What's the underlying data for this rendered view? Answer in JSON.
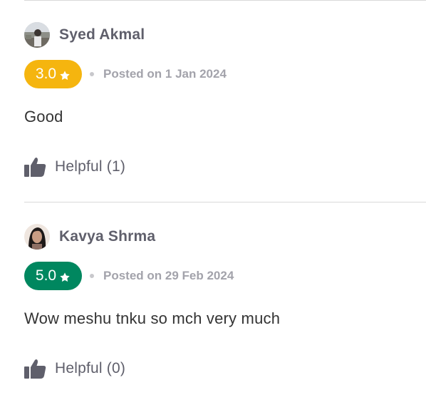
{
  "reviews": [
    {
      "reviewer_name": "Syed Akmal",
      "avatar": "photo-avatar-outdoor",
      "rating": "3.0",
      "rating_color": "#F5B50F",
      "star_icon": "star-icon",
      "posted_date": "Posted on 1 Jan 2024",
      "comment": "Good",
      "helpful_icon": "thumbs-up-icon",
      "helpful_label": "Helpful (1)"
    },
    {
      "reviewer_name": "Kavya Shrma",
      "avatar": "photo-avatar-portrait",
      "rating": "5.0",
      "rating_color": "#00875F",
      "star_icon": "star-icon",
      "posted_date": "Posted on 29 Feb 2024",
      "comment": "Wow meshu tnku so mch very much",
      "helpful_icon": "thumbs-up-icon",
      "helpful_label": "Helpful (0)"
    }
  ],
  "colors": {
    "name_text": "#5F5F6B",
    "meta_text": "#A3A3AB",
    "divider": "#D9D9D9"
  }
}
